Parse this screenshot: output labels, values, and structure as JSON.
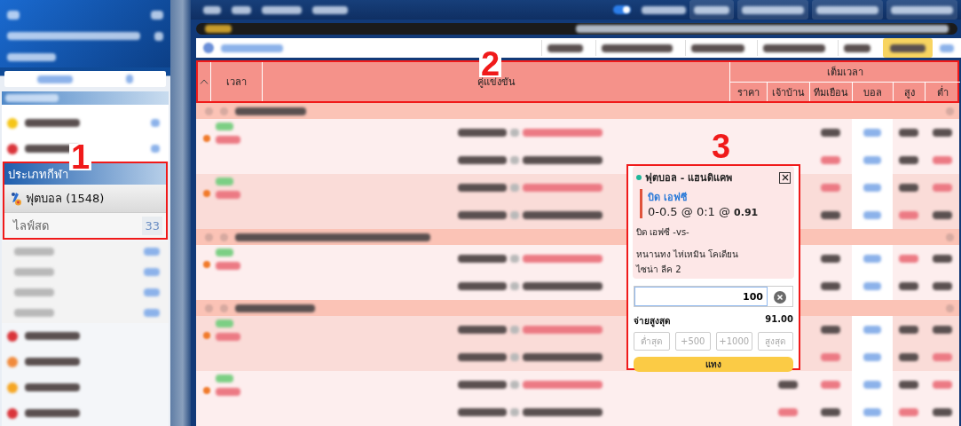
{
  "annotations": [
    {
      "label": "1"
    },
    {
      "label": "2"
    },
    {
      "label": "3"
    }
  ],
  "top_bar": {
    "toggle": {
      "on": true
    }
  },
  "sidebar": {
    "top_items": [
      {
        "kind": "sport",
        "color": "#f5c518"
      },
      {
        "kind": "sport",
        "color": "#d9343a"
      }
    ],
    "sport_type": {
      "title": "ประเภทกีฬา",
      "sport": {
        "label": "ฟุตบอล (1548)",
        "selected": true
      },
      "items": [
        {
          "label": "ไลฟ์สด",
          "count": "33"
        }
      ]
    },
    "bottom_items": [
      {
        "kind": "sub"
      },
      {
        "kind": "sub"
      },
      {
        "kind": "sub"
      },
      {
        "kind": "sub"
      },
      {
        "kind": "sport",
        "color": "#d9343a"
      },
      {
        "kind": "sport",
        "color": "#f08a3c"
      },
      {
        "kind": "sport",
        "color": "#f5a623"
      },
      {
        "kind": "sport",
        "color": "#d9343a"
      }
    ]
  },
  "table": {
    "columns": [
      {
        "label": "เวลา"
      },
      {
        "label": "คู่แข่งขัน"
      }
    ],
    "group": {
      "label": "เต็มเวลา",
      "columns": [
        {
          "label": "ราคา"
        },
        {
          "label": "เจ้าบ้าน"
        },
        {
          "label": "ทีมเยือน"
        },
        {
          "label": "บอล"
        },
        {
          "label": "สูง"
        },
        {
          "label": "ต่ำ"
        }
      ]
    },
    "rows": [
      {
        "kind": "league"
      },
      {
        "kind": "match"
      },
      {
        "kind": "match"
      },
      {
        "kind": "league"
      },
      {
        "kind": "match"
      },
      {
        "kind": "league"
      },
      {
        "kind": "match"
      },
      {
        "kind": "match"
      }
    ]
  },
  "bet_slip": {
    "title": "ฟุตบอล - แฮนดิแคพ",
    "pick": "บิด เอฟซี",
    "odds_line": "0-0.5 @ 0:1 @ **0.91**",
    "home": "บิด เอฟซี -vs-",
    "away": "หนานทง ไห่เหมิน โคเดียน",
    "league": "ไซน่า ลีค 2",
    "stake": "100",
    "max_payout_label": "จ่ายสูงสุด",
    "max_payout": "91.00",
    "quick_buttons": [
      {
        "label": "ต่ำสุด",
        "disabled": true
      },
      {
        "label": "+500",
        "disabled": true
      },
      {
        "label": "+1000",
        "disabled": true
      },
      {
        "label": "สูงสุด",
        "disabled": true
      }
    ],
    "submit": "แทง"
  }
}
